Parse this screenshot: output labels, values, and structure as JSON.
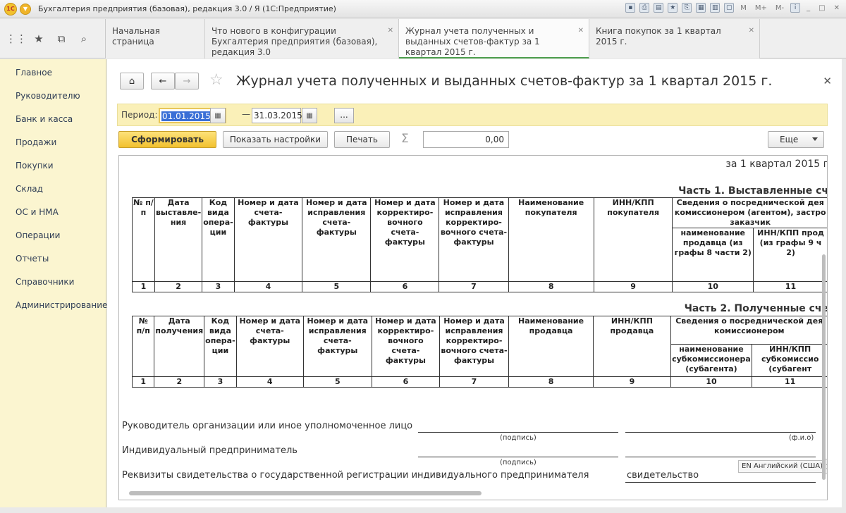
{
  "window": {
    "title": "Бухгалтерия предприятия (базовая), редакция 3.0 / Я  (1С:Предприятие)",
    "logo_text": "1С"
  },
  "title_tools": [
    "M",
    "M+",
    "M-"
  ],
  "tabs": [
    {
      "label": "Начальная страница",
      "active": false,
      "closable": false
    },
    {
      "label": "Что нового в конфигурации Бухгалтерия предприятия (базовая), редакция 3.0",
      "active": false,
      "closable": true
    },
    {
      "label": "Журнал учета полученных и выданных счетов-фактур за 1 квартал 2015 г.",
      "active": true,
      "closable": true
    },
    {
      "label": "Книга покупок за 1 квартал 2015 г.",
      "active": false,
      "closable": true
    }
  ],
  "sidebar": {
    "items": [
      {
        "label": "Главное"
      },
      {
        "label": "Руководителю"
      },
      {
        "label": "Банк и касса"
      },
      {
        "label": "Продажи"
      },
      {
        "label": "Покупки"
      },
      {
        "label": "Склад"
      },
      {
        "label": "ОС и НМА"
      },
      {
        "label": "Операции"
      },
      {
        "label": "Отчеты"
      },
      {
        "label": "Справочники"
      },
      {
        "label": "Администрирование"
      }
    ]
  },
  "form": {
    "title": "Журнал учета полученных и выданных счетов-фактур за 1 квартал 2015 г.",
    "period_label": "Период:",
    "date_from": "01.01.2015",
    "date_to": "31.03.2015",
    "dash": "—",
    "dots": "...",
    "generate_button": "Сформировать",
    "settings_button": "Показать настройки",
    "print_button": "Печать",
    "sum_value": "0,00",
    "more_button": "Еще"
  },
  "report": {
    "quarter": "за 1 квартал 2015 г",
    "part1": {
      "title": "Часть 1. Выставленные сч",
      "headers": [
        "№ п/п",
        "Дата выставле-ния",
        "Код вида опера-ции",
        "Номер и дата счета-фактуры",
        "Номер и дата исправления счета-фактуры",
        "Номер и дата корректиро-вочного счета-фактуры",
        "Номер и дата исправления корректиро-вочного счета-фактуры",
        "Наименование покупателя",
        "ИНН/КПП покупателя",
        "Сведения о посреднической дея комиссионером (агентом), застро заказчик"
      ],
      "subheaders": [
        "наименование продавца (из графы 8 части 2)",
        "ИНН/КПП прод (из графы 9 ч 2)"
      ],
      "numbers": [
        "1",
        "2",
        "3",
        "4",
        "5",
        "6",
        "7",
        "8",
        "9",
        "10",
        "11"
      ]
    },
    "part2": {
      "title": "Часть 2. Полученные сче",
      "headers": [
        "№ п/п",
        "Дата получения",
        "Код вида опера-ции",
        "Номер и дата счета-фактуры",
        "Номер и дата исправления счета-фактуры",
        "Номер и дата корректиро-вочного счета-фактуры",
        "Номер и дата исправления корректиро-вочного счета-фактуры",
        "Наименование продавца",
        "ИНН/КПП продавца",
        "Сведения о посреднической дея комиссионером"
      ],
      "subheaders": [
        "наименование субкомиссионера (субагента)",
        "ИНН/КПП субкомиссио (субагент"
      ],
      "numbers": [
        "1",
        "2",
        "3",
        "4",
        "5",
        "6",
        "7",
        "8",
        "9",
        "10",
        "11"
      ]
    },
    "signatures": {
      "head_label": "Руководитель организации или иное уполномоченное лицо",
      "ip_label": "Индивидуальный предприниматель",
      "reg_label": "Реквизиты свидетельства о государственной регистрации индивидуального предпринимателя",
      "sign_caption": "(подпись)",
      "fio_caption": "(ф.и.о)",
      "cert_value": "свидетельство"
    },
    "lang_tip": "EN Английский (США)"
  }
}
